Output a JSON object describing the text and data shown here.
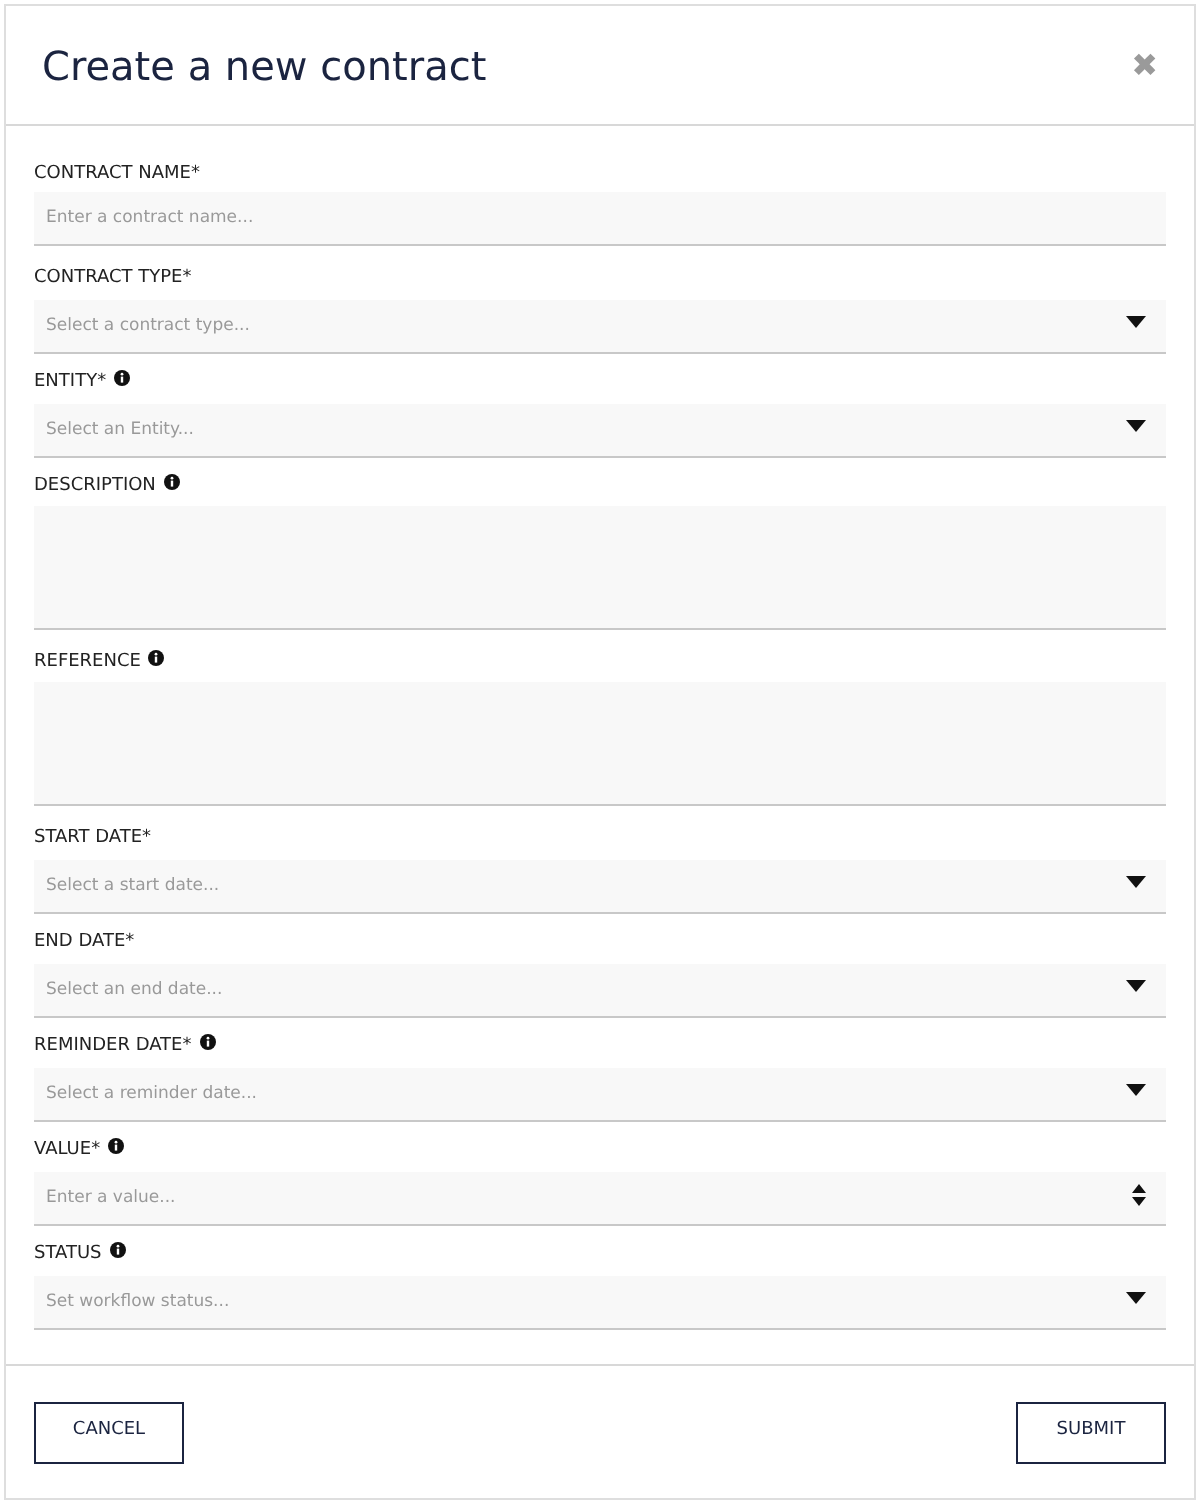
{
  "dialog": {
    "title": "Create a new contract",
    "close": "✖"
  },
  "fields": [
    {
      "label": "CONTRACT NAME*",
      "info": false,
      "kind": "text",
      "placeholder": "Enter a contract name..."
    },
    {
      "label": "CONTRACT TYPE*",
      "info": false,
      "kind": "select",
      "placeholder": "Select a contract type..."
    },
    {
      "label": "ENTITY*",
      "info": true,
      "kind": "select",
      "placeholder": "Select an Entity..."
    },
    {
      "label": "DESCRIPTION",
      "info": true,
      "kind": "textarea"
    },
    {
      "label": "REFERENCE",
      "info": true,
      "kind": "textarea"
    },
    {
      "label": "START DATE*",
      "info": false,
      "kind": "select",
      "placeholder": "Select a start date..."
    },
    {
      "label": "END DATE*",
      "info": false,
      "kind": "select",
      "placeholder": "Select an end date..."
    },
    {
      "label": "REMINDER DATE*",
      "info": true,
      "kind": "select",
      "placeholder": "Select a reminder date..."
    },
    {
      "label": "VALUE*",
      "info": true,
      "kind": "number",
      "placeholder": "Enter a value..."
    },
    {
      "label": "STATUS",
      "info": true,
      "kind": "select",
      "placeholder": "Set workflow status..."
    }
  ],
  "buttons": [
    {
      "label": "CANCEL"
    },
    {
      "label": "SUBMIT"
    }
  ]
}
